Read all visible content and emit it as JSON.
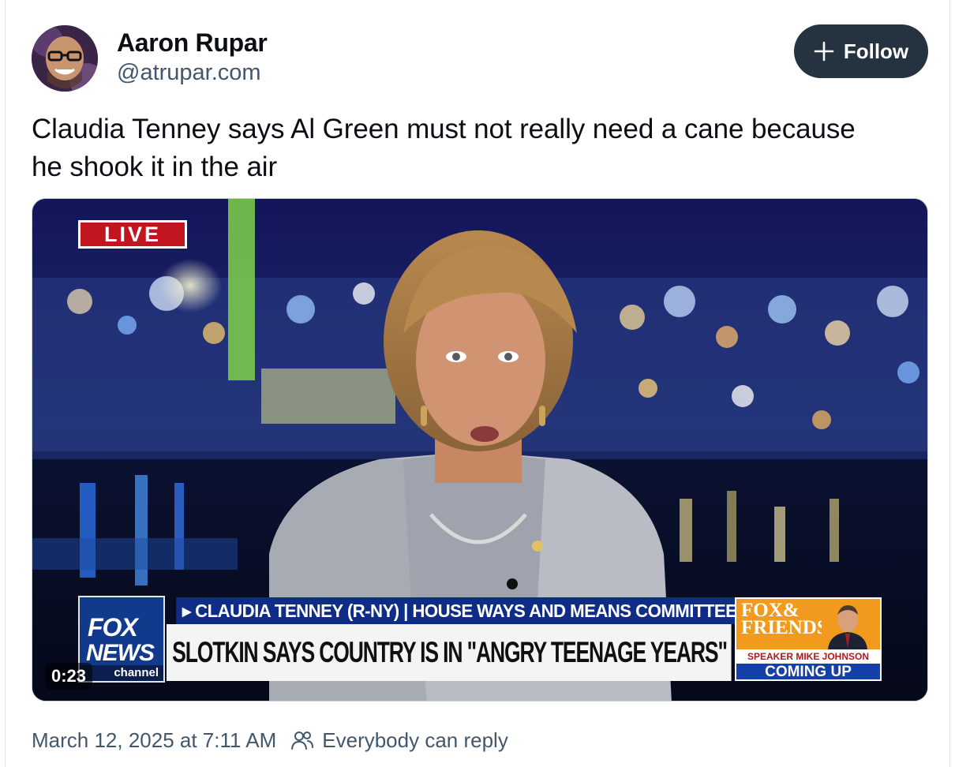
{
  "author": {
    "name": "Aaron Rupar",
    "handle": "@atrupar.com"
  },
  "follow_button": {
    "label": "Follow",
    "icon": "plus-icon"
  },
  "post": {
    "text": "Claudia Tenney says Al Green must not really need a cane because he shook it in the air"
  },
  "video": {
    "timestamp": "0:23",
    "live_badge": "LIVE",
    "network_logo": [
      "FOX",
      "NEWS",
      "channel"
    ],
    "banner_top": "▸ CLAUDIA TENNEY (R-NY) | HOUSE WAYS AND MEANS COMMITTEE",
    "banner_main": "SLOTKIN SAYS COUNTRY IS IN \"ANGRY TEENAGE YEARS\"",
    "promo": {
      "show_line1": "FOX&",
      "show_line2": "FRIENDS",
      "speaker": "SPEAKER MIKE JOHNSON",
      "coming_up": "COMING UP"
    }
  },
  "footer": {
    "date": "March 12, 2025 at 7:11 AM",
    "reply_setting": "Everybody can reply",
    "reply_icon": "people-icon"
  },
  "colors": {
    "follow_bg": "#25323f",
    "secondary_text": "#42576c",
    "live_red": "#c2151f",
    "fox_blue": "#0f2d86",
    "promo_orange": "#f29a1e"
  }
}
